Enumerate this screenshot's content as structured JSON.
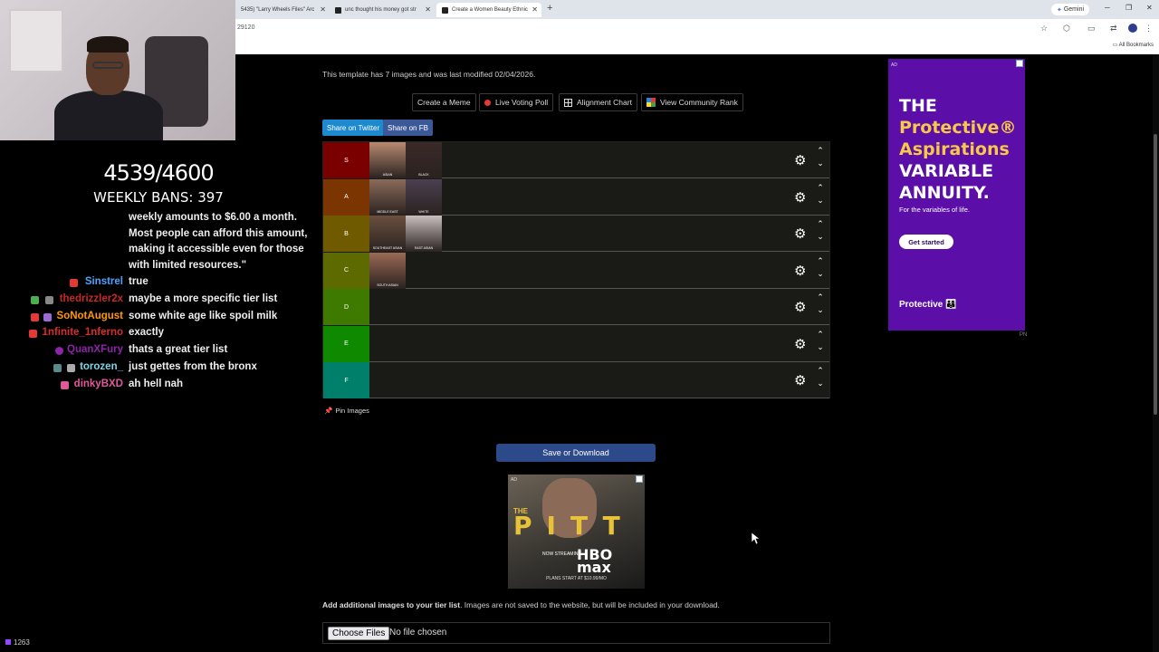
{
  "browser": {
    "tabs": [
      {
        "label": "5435) \"Larry Wheels Files\" Arc",
        "active": false
      },
      {
        "label": "unc thought his money got str",
        "active": false
      },
      {
        "label": "Create a Women Beauty Ethnic",
        "active": true
      }
    ],
    "gemini_label": "Gemini",
    "url": "29120",
    "all_bookmarks": "All Bookmarks"
  },
  "stream": {
    "ban_count": "4539/4600",
    "weekly_bans": "WEEKLY BANS: 397",
    "chat_continuation": [
      "weekly amounts to $6.00 a month.",
      "Most people can afford this amount,",
      "making it accessible even for those",
      "with limited resources.\""
    ],
    "chat": [
      {
        "user": "Sinstrel",
        "message": "true",
        "color": "#4aa3ff"
      },
      {
        "user": "thedrizzler2x",
        "message": "maybe a more specific tier list",
        "color": "#c62828"
      },
      {
        "user": "SoNotAugust",
        "message": "some white age like spoil milk",
        "color": "#ff9800"
      },
      {
        "user": "1nfinite_1nferno",
        "message": "exactly",
        "color": "#d32f2f"
      },
      {
        "user": "QuanXFury",
        "message": "thats a great tier list",
        "color": "#8e24aa"
      },
      {
        "user": "torozen_",
        "message": "just gettes from the bronx",
        "color": "#7fd3e6"
      },
      {
        "user": "dinkyBXD",
        "message": "ah hell nah",
        "color": "#e05a9a"
      }
    ],
    "viewers": "1263"
  },
  "page": {
    "info": "This template has 7 images and was last modified 02/04/2026.",
    "buttons": {
      "create_meme": "Create a Meme",
      "live_poll": "Live Voting Poll",
      "alignment": "Alignment Chart",
      "community": "View Community Rank"
    },
    "share_twitter": "Share on Twitter",
    "share_fb": "Share on FB",
    "tiers": [
      {
        "label": "S",
        "color": "#7a0000",
        "images": [
          "ASIAN",
          "BLACK"
        ]
      },
      {
        "label": "A",
        "color": "#7a3500",
        "images": [
          "MIDDLE EAST",
          "WHITE"
        ]
      },
      {
        "label": "B",
        "color": "#6f5a00",
        "images": [
          "SOUTHEAST ASIAN",
          "EAST ASIAN"
        ]
      },
      {
        "label": "C",
        "color": "#5c6a00",
        "images": [
          "SOUTH ASIAN"
        ]
      },
      {
        "label": "D",
        "color": "#3f7a00",
        "images": []
      },
      {
        "label": "E",
        "color": "#0f8a00",
        "images": []
      },
      {
        "label": "F",
        "color": "#00806a",
        "images": []
      }
    ],
    "pin_images": "Pin Images",
    "save_download": "Save or Download",
    "add_images_bold": "Add additional images to your tier list",
    "add_images_rest": ". Images are not saved to the website, but will be included in your download.",
    "choose_files": "Choose Files",
    "no_file": "No file chosen"
  },
  "ads": {
    "right": {
      "line1": "THE",
      "line2": "Protective®",
      "line3": "Aspirations",
      "line4": "VARIABLE",
      "line5": "ANNUITY.",
      "sub": "For the variables of life.",
      "cta": "Get started",
      "brand": "Protective",
      "tag": "AD",
      "pn": "PN"
    },
    "center": {
      "the": "THE",
      "title": "PITT",
      "now": "NOW STREAMING",
      "brand": "HBO max",
      "plans": "PLANS START AT $10.99/MO",
      "tag": "AD"
    }
  }
}
